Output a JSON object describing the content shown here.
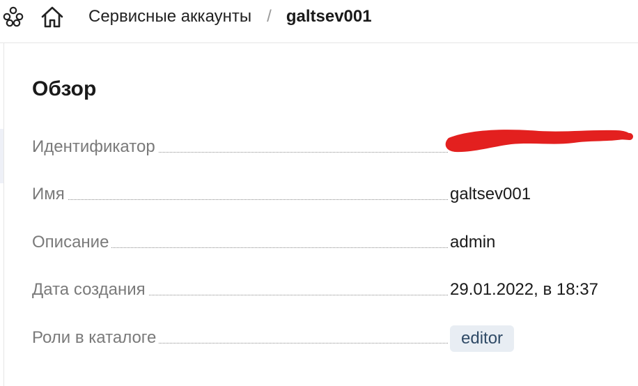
{
  "header": {
    "breadcrumb_parent": "Сервисные аккаунты",
    "breadcrumb_separator": "/",
    "breadcrumb_current": "galtsev001"
  },
  "overview": {
    "title": "Обзор",
    "rows": [
      {
        "label": "Идентификатор",
        "value": ""
      },
      {
        "label": "Имя",
        "value": "galtsev001"
      },
      {
        "label": "Описание",
        "value": "admin"
      },
      {
        "label": "Дата создания",
        "value": "29.01.2022, в 18:37"
      },
      {
        "label": "Роли в каталоге",
        "value": "editor"
      }
    ]
  },
  "colors": {
    "redaction": "#e3201f",
    "badge_bg": "#e8edf3",
    "label_gray": "#7a7a7a"
  },
  "icons": [
    "services-icon",
    "home-icon"
  ]
}
